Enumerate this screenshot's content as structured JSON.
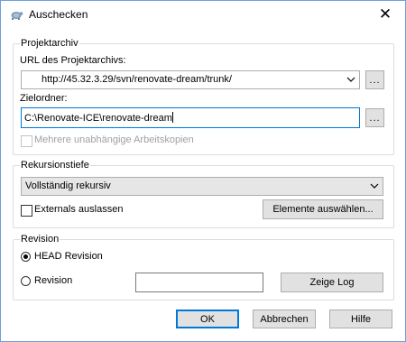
{
  "window": {
    "title": "Auschecken",
    "close_glyph": "✕"
  },
  "repo_group": {
    "label": "Projektarchiv",
    "url_label": "URL des Projektarchivs:",
    "url_value": "http://45.32.3.29/svn/renovate-dream/trunk/",
    "browse_label": "...",
    "target_label": "Zielordner:",
    "target_value": "C:\\Renovate-ICE\\renovate-dream",
    "target_browse_label": "...",
    "independent_wc_label": "Mehrere unabhängige Arbeitskopien",
    "independent_wc_checked": false,
    "independent_wc_enabled": false
  },
  "recursion_group": {
    "label": "Rekursionstiefe",
    "depth_value": "Vollständig rekursiv",
    "omit_externals_label": "Externals auslassen",
    "omit_externals_checked": false,
    "choose_items_label": "Elemente auswählen..."
  },
  "revision_group": {
    "label": "Revision",
    "head_label": "HEAD Revision",
    "head_selected": true,
    "revision_label": "Revision",
    "revision_selected": false,
    "revision_value": "",
    "show_log_label": "Zeige Log"
  },
  "buttons": {
    "ok": "OK",
    "cancel": "Abbrechen",
    "help": "Hilfe"
  },
  "colors": {
    "accent": "#0078d7",
    "button_face": "#e1e1e1",
    "group_border": "#dcdcdc",
    "disabled_text": "#a0a0a0"
  },
  "icons": {
    "app": "tortoisesvn-turtle-icon",
    "dropdown": "chevron-down-icon",
    "close": "close-icon"
  }
}
